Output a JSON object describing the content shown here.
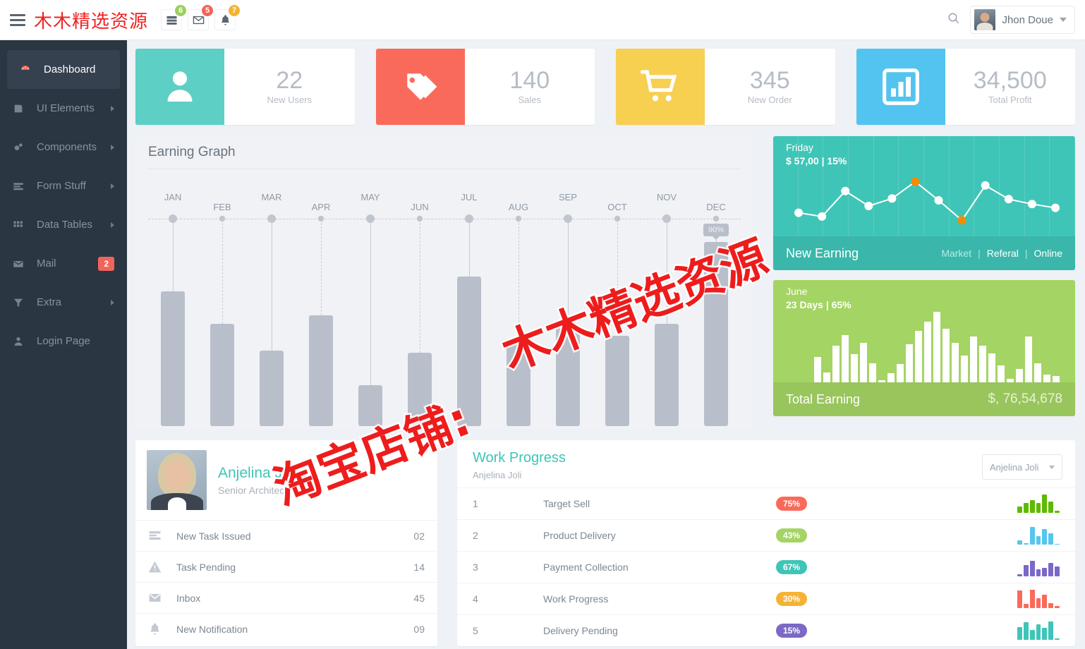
{
  "header": {
    "brand": "木木精选资源",
    "icons": [
      {
        "name": "tasks-icon",
        "badge": "6",
        "color": "#9bcf5f"
      },
      {
        "name": "mail-icon",
        "badge": "5",
        "color": "#f1645b"
      },
      {
        "name": "bell-icon",
        "badge": "7",
        "color": "#f5b335"
      }
    ],
    "user_name": "Jhon Doue"
  },
  "sidebar": {
    "items": [
      {
        "label": "Dashboard",
        "icon": "dashboard-icon",
        "active": true
      },
      {
        "label": "UI Elements",
        "icon": "layers-icon",
        "arrow": true
      },
      {
        "label": "Components",
        "icon": "gears-icon",
        "arrow": true
      },
      {
        "label": "Form Stuff",
        "icon": "form-icon",
        "arrow": true
      },
      {
        "label": "Data Tables",
        "icon": "grid-icon",
        "arrow": true
      },
      {
        "label": "Mail",
        "icon": "envelope-icon",
        "badge": "2"
      },
      {
        "label": "Extra",
        "icon": "funnel-icon",
        "arrow": true
      },
      {
        "label": "Login Page",
        "icon": "user-icon"
      }
    ]
  },
  "stats": [
    {
      "value": "22",
      "label": "New Users",
      "color": "#5ecfc4",
      "icon": "person-icon"
    },
    {
      "value": "140",
      "label": "Sales",
      "color": "#fa6a5a",
      "icon": "tag-icon"
    },
    {
      "value": "345",
      "label": "New Order",
      "color": "#f7cf51",
      "icon": "cart-icon"
    },
    {
      "value": "34,500",
      "label": "Total Profit",
      "color": "#53c4ef",
      "icon": "bar-chart-icon"
    }
  ],
  "earning_graph": {
    "title": "Earning Graph",
    "tooltip": "90%",
    "tooltip_month": "DEC"
  },
  "new_earning": {
    "day": "Friday",
    "amount": "$ 57,00 | 15%",
    "footer_title": "New Earning",
    "tabs": [
      "Market",
      "Referal",
      "Online"
    ]
  },
  "total_earning": {
    "month": "June",
    "amount": "23 Days | 65%",
    "footer_title": "Total Earning",
    "total": "$, 76,54,678"
  },
  "profile": {
    "name": "Anjelina Joli",
    "role": "Senior Architect",
    "items": [
      {
        "label": "New Task Issued",
        "count": "02",
        "icon": "list-icon"
      },
      {
        "label": "Task Pending",
        "count": "14",
        "icon": "warning-icon"
      },
      {
        "label": "Inbox",
        "count": "45",
        "icon": "envelope-icon"
      },
      {
        "label": "New Notification",
        "count": "09",
        "icon": "bell-icon"
      }
    ]
  },
  "work_progress": {
    "title": "Work Progress",
    "subtitle": "Anjelina Joli",
    "select_value": "Anjelina Joli",
    "rows": [
      {
        "index": "1",
        "name": "Target Sell",
        "percent": "75%",
        "badge_color": "#fa6a5a",
        "spark_color": "#5eba00"
      },
      {
        "index": "2",
        "name": "Product Delivery",
        "percent": "43%",
        "badge_color": "#a4d464",
        "spark_color": "#56c6ee"
      },
      {
        "index": "3",
        "name": "Payment Collection",
        "percent": "67%",
        "badge_color": "#3fc5b7",
        "spark_color": "#7b68c7"
      },
      {
        "index": "4",
        "name": "Work Progress",
        "percent": "30%",
        "badge_color": "#f5b335",
        "spark_color": "#fa6a5a"
      },
      {
        "index": "5",
        "name": "Delivery Pending",
        "percent": "15%",
        "badge_color": "#7b68c7",
        "spark_color": "#3fc5b7"
      }
    ]
  },
  "watermark": [
    "木木精选资源",
    "淘宝店铺:"
  ],
  "chart_data": [
    {
      "type": "bar",
      "title": "Earning Graph",
      "categories": [
        "JAN",
        "FEB",
        "MAR",
        "APR",
        "MAY",
        "JUN",
        "JUL",
        "AUG",
        "SEP",
        "OCT",
        "NOV",
        "DEC"
      ],
      "values": [
        66,
        50,
        37,
        54,
        20,
        36,
        73,
        42,
        48,
        44,
        50,
        90
      ],
      "ylabel": "",
      "xlabel": "",
      "ylim": [
        0,
        100
      ],
      "grid": false,
      "annotation": "90%"
    },
    {
      "type": "line",
      "title": "New Earning",
      "x": [
        1,
        2,
        3,
        4,
        5,
        6,
        7,
        8,
        9,
        10,
        11,
        12
      ],
      "values": [
        22,
        16,
        57,
        33,
        45,
        72,
        42,
        10,
        66,
        44,
        36,
        30
      ],
      "highlight_indices": [
        5,
        7
      ],
      "ylim": [
        0,
        100
      ],
      "grid": true,
      "legend": [
        "Market",
        "Referal",
        "Online"
      ]
    },
    {
      "type": "bar",
      "title": "Total Earning",
      "x": [
        1,
        2,
        3,
        4,
        5,
        6,
        7,
        8,
        9,
        10,
        11,
        12,
        13,
        14,
        15,
        16,
        17,
        18,
        19,
        20,
        21,
        22,
        23,
        24,
        25,
        26,
        27
      ],
      "values": [
        33,
        13,
        48,
        62,
        37,
        52,
        25,
        3,
        12,
        24,
        50,
        68,
        80,
        93,
        70,
        52,
        35,
        60,
        48,
        38,
        22,
        5,
        18,
        60,
        25,
        10,
        8
      ],
      "ylim": [
        0,
        100
      ],
      "grid": false
    }
  ]
}
